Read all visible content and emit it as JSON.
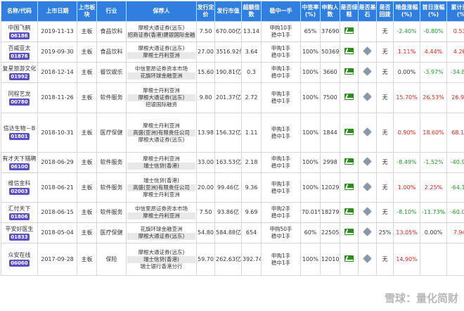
{
  "headers": [
    "名称/代码",
    "上市日期",
    "上市板块",
    "行业",
    "保荐人",
    "发行定价",
    "发行市值",
    "超额倍数",
    "稳中一手",
    "中签率(%)",
    "申购人数",
    "是否绿鞋",
    "是否基石",
    "是否回拨",
    "暗盘涨幅(%)",
    "首日涨幅(%)",
    "累计涨幅(%)"
  ],
  "rows": [
    {
      "name": "中国飞鹤",
      "code": "06186",
      "date": "2019-11-13",
      "board": "主板",
      "industry": "食品饮料",
      "sponsors": [
        "摩根大通证券(远东)",
        "招商证券(香港)建银国际金融"
      ],
      "price": "7.50",
      "mcap": "670.00亿",
      "oversub": "13.14",
      "lot": [
        "申购10手",
        "稳中1手"
      ],
      "rate": "65%",
      "applicants": "37690",
      "greenshoe": true,
      "cornerstone": false,
      "clawback": "无",
      "dark": "-2.40%",
      "dark_c": "green",
      "first": "-0.80%",
      "first_c": "green",
      "cum": "0.53%",
      "cum_c": "red"
    },
    {
      "name": "百威亚太",
      "code": "01876",
      "date": "2019-09-30",
      "board": "主板",
      "industry": "食品饮料",
      "sponsors": [
        "摩根大通证券(远东)",
        "摩根士丹利亚洲"
      ],
      "price": "27.00",
      "mcap": "3516.92亿",
      "oversub": "3.64",
      "lot": [
        "申购1手",
        "稳中1手"
      ],
      "rate": "100%",
      "applicants": "50369",
      "greenshoe": true,
      "cornerstone": true,
      "clawback": "无",
      "dark": "1.11%",
      "dark_c": "red",
      "first": "4.44%",
      "first_c": "red",
      "cum": "4.26%",
      "cum_c": "red"
    },
    {
      "name": "复星旅游文化",
      "code": "01992",
      "date": "2018-12-14",
      "board": "主板",
      "industry": "餐饮娱乐",
      "sponsors": [
        "中信里昂证券资本市场",
        "花旗环球金融亚洲"
      ],
      "price": "15.60",
      "mcap": "190.81亿",
      "oversub": "0.3",
      "lot": [
        "申购1手",
        "稳中1手"
      ],
      "rate": "100%",
      "applicants": "3660",
      "greenshoe": true,
      "cornerstone": true,
      "clawback": "无",
      "dark": "0.00%",
      "dark_c": "",
      "first": "-3.97%",
      "first_c": "green",
      "cum": "-34.87%",
      "cum_c": "green"
    },
    {
      "name": "同程艺龙",
      "code": "00780",
      "date": "2018-11-26",
      "board": "主板",
      "industry": "软件服务",
      "sponsors": [
        "摩根士丹利亚洲",
        "摩根大通证券(远东)",
        "招银国际融资"
      ],
      "price": "9.80",
      "mcap": "201.37亿",
      "oversub": "2.72",
      "lot": [
        "申购1手",
        "稳中1手"
      ],
      "rate": "100%",
      "applicants": "7500",
      "greenshoe": true,
      "cornerstone": true,
      "clawback": "无",
      "dark": "15.70%",
      "dark_c": "red",
      "first": "26.53%",
      "first_c": "red",
      "cum": "26.94%",
      "cum_c": "red"
    },
    {
      "name": "信达生物－B",
      "code": "01801",
      "date": "2018-10-31",
      "board": "主板",
      "industry": "医疗保健",
      "sponsors": [
        "摩根士丹利亚洲",
        "高盛(亚洲)有限责任公司",
        "摩根大通证券(远东)"
      ],
      "price": "13.98",
      "mcap": "156.32亿",
      "oversub": "1.11",
      "lot": [
        "申购1手",
        "稳中1手"
      ],
      "rate": "100%",
      "applicants": "1844",
      "greenshoe": true,
      "cornerstone": true,
      "clawback": "无",
      "dark": "0.90%",
      "dark_c": "red",
      "first": "18.60%",
      "first_c": "red",
      "cum": "68.10%",
      "cum_c": "red"
    },
    {
      "name": "有才天下猎聘",
      "code": "06100",
      "date": "2018-06-29",
      "board": "主板",
      "industry": "软件服务",
      "sponsors": [
        "摩根士丹利亚洲",
        "瑞士信贷(香港)"
      ],
      "price": "33.00",
      "mcap": "163.53亿",
      "oversub": "2.18",
      "lot": [
        "申购1手",
        "稳中1手"
      ],
      "rate": "100%",
      "applicants": "2998",
      "greenshoe": true,
      "cornerstone": true,
      "clawback": "无",
      "dark": "-8.49%",
      "dark_c": "green",
      "first": "-1.52%",
      "first_c": "green",
      "cum": "-40.91%",
      "cum_c": "green"
    },
    {
      "name": "维信金科",
      "code": "02003",
      "date": "2018-06-21",
      "board": "主板",
      "industry": "软件服务",
      "sponsors": [
        "瑞士信贷(香港)",
        "高盛(亚洲)有限责任公司",
        "摩根士丹利亚洲"
      ],
      "price": "20.00",
      "mcap": "99.46亿",
      "oversub": "9.36",
      "lot": [
        "申购1手",
        "稳中1手"
      ],
      "rate": "100%",
      "applicants": "12029",
      "greenshoe": true,
      "cornerstone": true,
      "clawback": "无",
      "dark": "1.00%",
      "dark_c": "red",
      "first": "2.25%",
      "first_c": "red",
      "cum": "-64.15%",
      "cum_c": "green"
    },
    {
      "name": "汇付天下",
      "code": "01806",
      "date": "2018-06-15",
      "board": "主板",
      "industry": "软件服务",
      "sponsors": [
        "中信里昂证券资本市场",
        "摩根士丹利亚洲"
      ],
      "price": "7.50",
      "mcap": "93.86亿",
      "oversub": "9.69",
      "lot": [
        "申购2手",
        "稳中1手"
      ],
      "rate": "70.01%",
      "applicants": "18279",
      "greenshoe": true,
      "cornerstone": true,
      "clawback": "无",
      "dark": "-8.10%",
      "dark_c": "green",
      "first": "-11.73%",
      "first_c": "green",
      "cum": "-60.00%",
      "cum_c": "green"
    },
    {
      "name": "平安好医生",
      "code": "01833",
      "date": "2018-05-04",
      "board": "主板",
      "industry": "医疗保健",
      "sponsors": [
        "花旗环球金融亚洲",
        "摩根大通证券(远东)"
      ],
      "price": "54.80",
      "mcap": "584.88亿",
      "oversub": "654",
      "lot": [
        "申购50手",
        "稳中1手"
      ],
      "rate": "60%",
      "applicants": "225058",
      "greenshoe": true,
      "cornerstone": true,
      "clawback": "25%",
      "dark": "13.05%",
      "dark_c": "red",
      "first": "0.00%",
      "first_c": "",
      "cum": "7.94%",
      "cum_c": "red"
    },
    {
      "name": "众安在线",
      "code": "06060",
      "date": "2017-09-28",
      "board": "主板",
      "industry": "保险",
      "sponsors": [
        "摩根大通证券(远东)",
        "瑞士信贷(香港)",
        "瑞士银行香港分行"
      ],
      "price": "59.70",
      "mcap": "262.63亿",
      "oversub": "392.74",
      "lot": [
        "申购1手",
        "稳中1手"
      ],
      "rate": "100%",
      "applicants": "120106",
      "greenshoe": true,
      "cornerstone": true,
      "clawback": "无",
      "dark": "14.90%",
      "dark_c": "red",
      "first": "",
      "first_c": "",
      "cum": "",
      "cum_c": ""
    }
  ],
  "watermark": "雪球：量化简财",
  "colors": {
    "header_bg": "#2f7ee0",
    "code_bg": "#5a4fc4",
    "up": "#e0261c",
    "down": "#1f9a2a"
  }
}
